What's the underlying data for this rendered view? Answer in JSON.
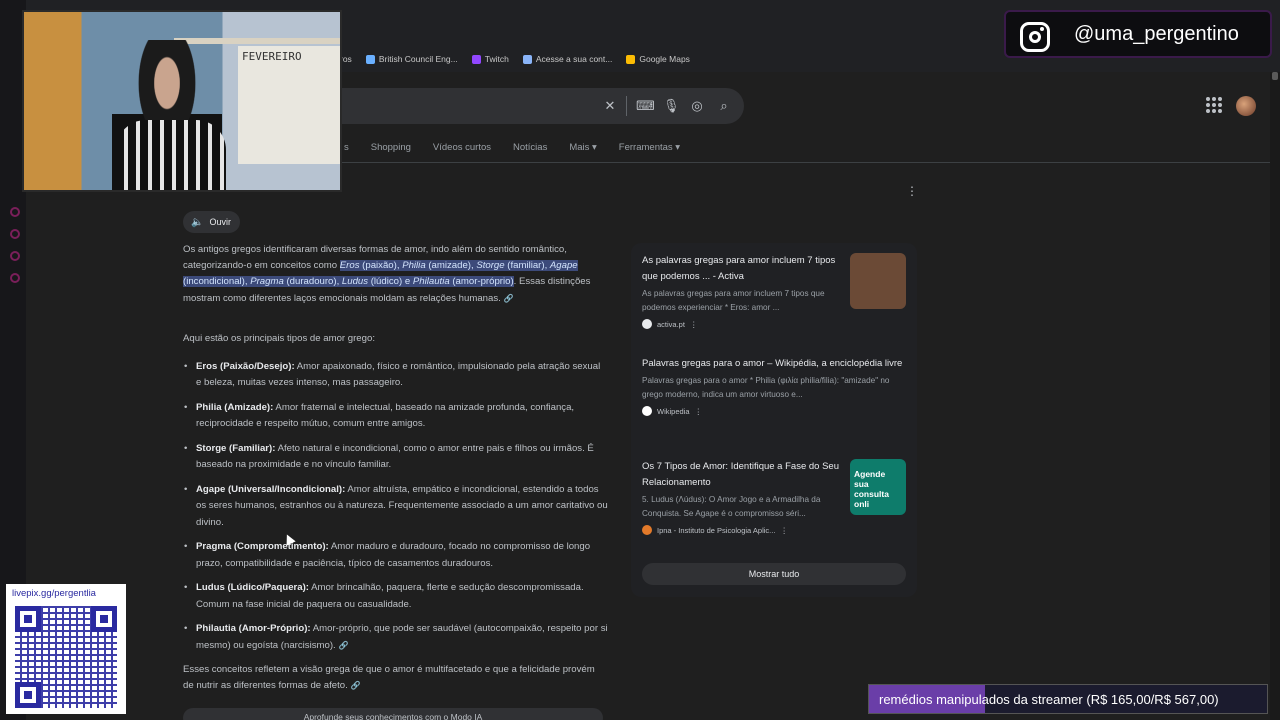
{
  "bookmarks": [
    {
      "label": "ros",
      "color": "#8a8a8a"
    },
    {
      "label": "British Council Eng...",
      "color": "#6ab0ff"
    },
    {
      "label": "Twitch",
      "color": "#9147ff"
    },
    {
      "label": "Acesse a sua cont...",
      "color": "#8ab4f8"
    },
    {
      "label": "Google Maps",
      "color": "#fbbc04"
    }
  ],
  "search": {
    "clear_icon": "close-icon",
    "keyboard_icon": "keyboard-icon",
    "mic_icon": "mic-icon",
    "lens_icon": "lens-icon",
    "search_icon": "search-icon"
  },
  "tabs": [
    "s",
    "Shopping",
    "Vídeos curtos",
    "Notícias",
    "Mais ▾",
    "Ferramentas ▾"
  ],
  "listen_label": "Ouvir",
  "answer": {
    "intro_a": "Os antigos gregos identificaram diversas formas de amor, indo além do sentido romântico, categorizando-o em conceitos como ",
    "hl1_i": "Eros",
    "hl1": " (paixão), ",
    "hl2_i": "Philia",
    "hl2": " (amizade), ",
    "hl3_i": "Storge",
    "hl3": " (familiar), ",
    "hl4_i": "Agape",
    "hl4": " (incondicional), ",
    "hl5_i": "Pragma",
    "hl5": " (duradouro), ",
    "hl6_i": "Ludus",
    "hl6": " (lúdico) e ",
    "hl7_i": "Philautia",
    "hl7": " (amor-próprio)",
    "intro_b": ". Essas distinções mostram como diferentes laços emocionais moldam as relações humanas.",
    "intro2": "Aqui estão os principais tipos de amor grego:",
    "types": [
      {
        "name": "Eros (Paixão/Desejo):",
        "desc": " Amor apaixonado, físico e romântico, impulsionado pela atração sexual e beleza, muitas vezes intenso, mas passageiro."
      },
      {
        "name": "Philia (Amizade):",
        "desc": " Amor fraternal e intelectual, baseado na amizade profunda, confiança, reciprocidade e respeito mútuo, comum entre amigos."
      },
      {
        "name": "Storge (Familiar):",
        "desc": " Afeto natural e incondicional, como o amor entre pais e filhos ou irmãos. É baseado na proximidade e no vínculo familiar."
      },
      {
        "name": "Agape (Universal/Incondicional):",
        "desc": " Amor altruísta, empático e incondicional, estendido a todos os seres humanos, estranhos ou à natureza. Frequentemente associado a um amor caritativo ou divino."
      },
      {
        "name": "Pragma (Comprometimento):",
        "desc": " Amor maduro e duradouro, focado no compromisso de longo prazo, compatibilidade e paciência, típico de casamentos duradouros."
      },
      {
        "name": "Ludus (Lúdico/Paquera):",
        "desc": " Amor brincalhão, paquera, flerte e sedução descompromissada. Comum na fase inicial de paquera ou casualidade."
      },
      {
        "name": "Philautia (Amor-Próprio):",
        "desc": " Amor-próprio, que pode ser saudável (autocompaixão, respeito por si mesmo) ou egoísta (narcisismo)."
      }
    ],
    "closing": "Esses conceitos refletem a visão grega de que o amor é multifacetado e que a felicidade provém de nutrir as diferentes formas de afeto.",
    "deepen": "Aprofunde seus conhecimentos com o Modo IA"
  },
  "sources": [
    {
      "title": "As palavras gregas para amor incluem 7 tipos que podemos ... - Activa",
      "snippet": "As palavras gregas para amor incluem 7 tipos que podemos experienciar * Eros: amor ...",
      "site": "activa.pt",
      "fav_color": "#e8eaed",
      "thumb_color": "#6b4a36"
    },
    {
      "title": "Palavras gregas para o amor – Wikipédia, a enciclopédia livre",
      "snippet": "Palavras gregas para o amor * Philia (φιλία philia/filia): \"amizade\" no grego moderno, indica um amor virtuoso e...",
      "site": "Wikipedia",
      "fav_color": "#ffffff"
    },
    {
      "title": "Os 7 Tipos de Amor: Identifique a Fase do Seu Relacionamento",
      "snippet": "5. Ludus (Λúdus): O Amor Jogo e a Armadilha da Conquista. Se Agape é o compromisso séri...",
      "site": "Ipna - Instituto de Psicologia Aplic...",
      "fav_color": "#e37a2a",
      "thumb_color": "#0e7c6b",
      "thumb_text": "Agende sua consulta onli"
    }
  ],
  "show_all": "Mostrar tudo",
  "overlay": {
    "cam_label": "FEVEREIRO",
    "insta_handle": "@uma_pergentino",
    "qr_url": "livepix.gg/pergentlia",
    "ticker": "remédios manipulados da streamer (R$ 165,00/R$ 567,00)",
    "ticker_progress": {
      "current": 165.0,
      "goal": 567.0
    }
  },
  "colors": {
    "accent_link": "#8ab4f8",
    "highlight": "#3c4a7a",
    "ticker_fill": "#6a3ea8",
    "brand_magenta": "#7a1f5a"
  }
}
